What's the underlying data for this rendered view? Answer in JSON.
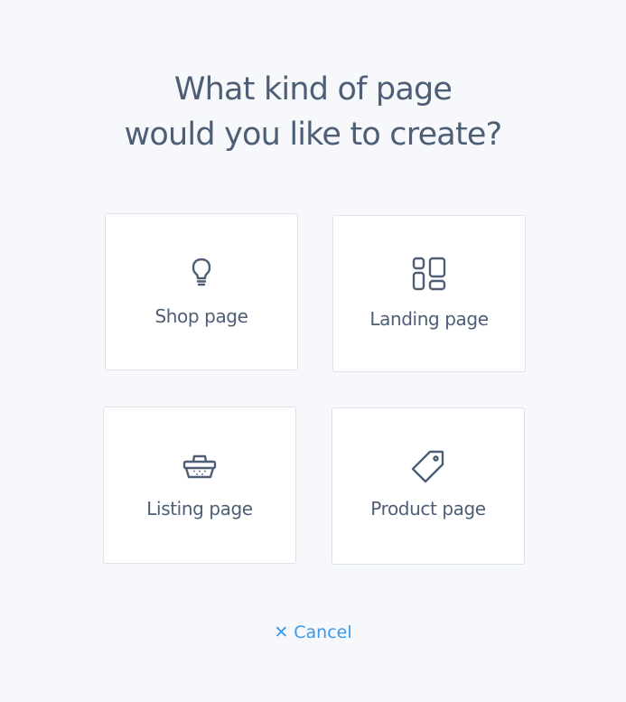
{
  "dialog": {
    "title_line1": "What kind of page",
    "title_line2": "would you like to create?"
  },
  "options": [
    {
      "label": "Shop page",
      "icon": "lightbulb-icon"
    },
    {
      "label": "Landing page",
      "icon": "layout-grid-icon"
    },
    {
      "label": "Listing page",
      "icon": "basket-icon"
    },
    {
      "label": "Product page",
      "icon": "tag-icon"
    }
  ],
  "cancel": {
    "icon": "close-icon",
    "label": "Cancel"
  },
  "colors": {
    "background": "#f6f8fb",
    "text": "#4d5e75",
    "accent": "#3a99e6",
    "card_border": "#dde2e8"
  }
}
